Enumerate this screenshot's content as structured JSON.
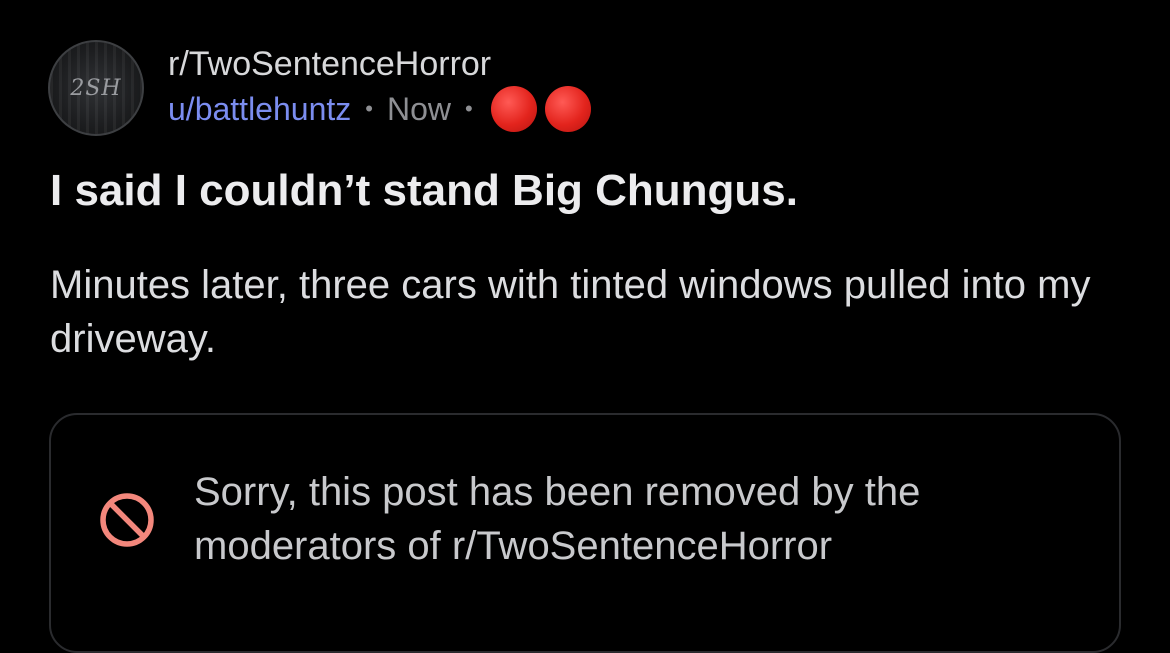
{
  "post": {
    "avatar_text": "2SH",
    "subreddit": "r/TwoSentenceHorror",
    "username": "u/battlehuntz",
    "separator": "•",
    "time": "Now",
    "award_count": 2,
    "title": "I said I couldn’t stand Big Chungus.",
    "body": "Minutes later, three cars with tinted windows pulled into my driveway."
  },
  "removed_notice": {
    "icon": "prohibited-icon",
    "message": "Sorry, this post has been removed by the moderators of r/TwoSentenceHorror"
  },
  "colors": {
    "background": "#000000",
    "username": "#7b8df0",
    "award_red": "#e3241d",
    "prohibited": "#f3877c"
  }
}
